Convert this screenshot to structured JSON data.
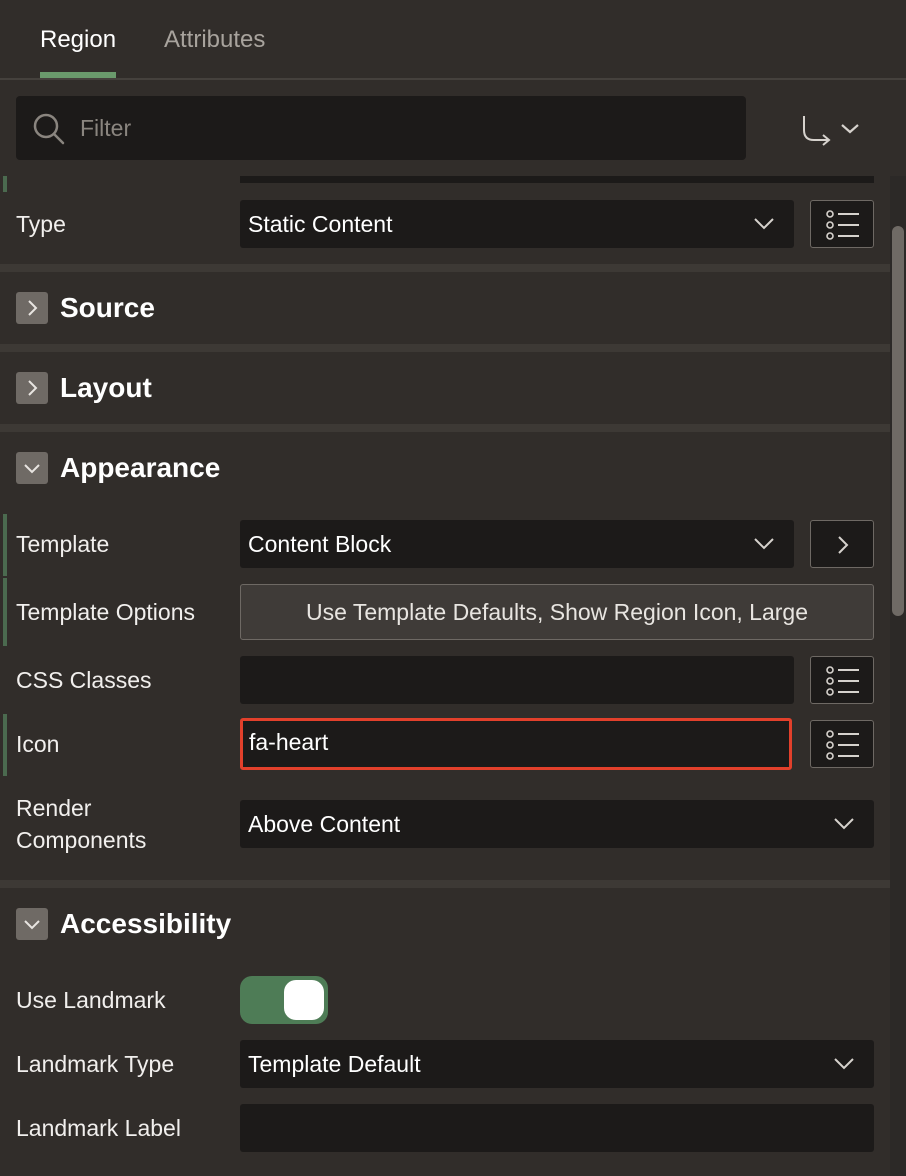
{
  "tabs": {
    "region": "Region",
    "attributes": "Attributes"
  },
  "filter": {
    "placeholder": "Filter"
  },
  "identification": {
    "type_label": "Type",
    "type_value": "Static Content"
  },
  "sections": {
    "source": "Source",
    "layout": "Layout",
    "appearance": "Appearance",
    "accessibility": "Accessibility"
  },
  "appearance": {
    "template_label": "Template",
    "template_value": "Content Block",
    "template_options_label": "Template Options",
    "template_options_value": "Use Template Defaults, Show Region Icon, Large",
    "css_classes_label": "CSS Classes",
    "css_classes_value": "",
    "icon_label": "Icon",
    "icon_value": "fa-heart",
    "render_components_label_line1": "Render",
    "render_components_label_line2": "Components",
    "render_components_value": "Above Content"
  },
  "accessibility": {
    "use_landmark_label": "Use Landmark",
    "use_landmark_on": true,
    "landmark_type_label": "Landmark Type",
    "landmark_type_value": "Template Default",
    "landmark_label_label": "Landmark Label",
    "landmark_label_value": ""
  },
  "colors": {
    "accent_green": "#6a9a6c",
    "highlight_red": "#e2402b",
    "toggle_on": "#4e7c56"
  },
  "icons": [
    "search-icon",
    "goto-arrow-icon",
    "chevron-down-icon",
    "list-picker-icon",
    "chevron-right-icon"
  ]
}
